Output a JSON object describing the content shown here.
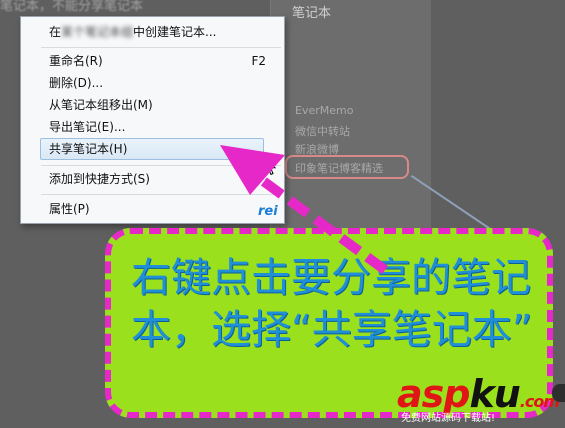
{
  "background": {
    "top_text": "笔记本，不能分享笔记本",
    "panel_title": "笔记本",
    "items": [
      {
        "label": "EverMemo"
      },
      {
        "label": "微信中转站"
      },
      {
        "label": "新浪微博"
      },
      {
        "label": "印象笔记博客精选"
      }
    ]
  },
  "context_menu": {
    "items": [
      {
        "label_prefix": "在",
        "label_blurred": "某个笔记本组",
        "label_suffix": "中创建笔记本...",
        "shortcut": ""
      },
      {
        "label": "重命名(R)",
        "shortcut": "F2"
      },
      {
        "label": "删除(D)...",
        "shortcut": ""
      },
      {
        "label": "从笔记本组移出(M)",
        "shortcut": ""
      },
      {
        "label": "导出笔记(E)...",
        "shortcut": ""
      },
      {
        "label": "共享笔记本(H)",
        "shortcut": "",
        "selected": true
      },
      {
        "label": "添加到快捷方式(S)",
        "shortcut": ""
      },
      {
        "label": "属性(P)",
        "shortcut": ""
      }
    ],
    "corner_mark": "rei"
  },
  "callout": {
    "text": "右键点击要分享的笔记本，选择“共享笔记本”",
    "color_fill": "#9be01c",
    "color_border": "#e628c8",
    "color_text": "#1f8fd8"
  },
  "watermark": {
    "brand_a": "asp",
    "brand_b": "ku",
    "brand_c": ".com",
    "subtitle": "免费网站源码下载站!"
  }
}
